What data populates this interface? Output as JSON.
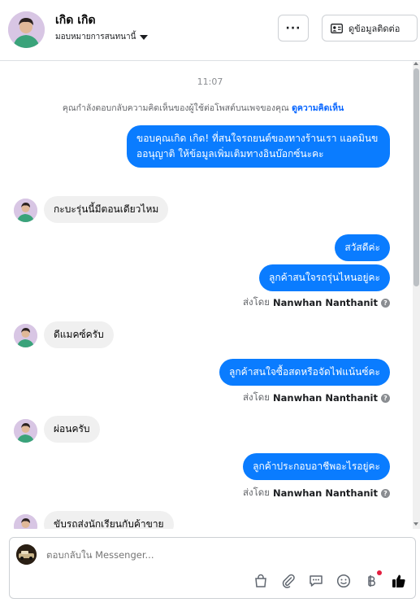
{
  "header": {
    "name": "เกิด เกิด",
    "assign_label": "มอบหมายการสนทนานี้",
    "more_label": "···",
    "contact_label": "ดูข้อมูลติดต่อ"
  },
  "thread": {
    "time": "11:07",
    "note_text": "คุณกำลังตอบกลับความคิดเห็นของผู้ใช้ต่อโพสต์บนเพจของคุณ ",
    "note_link": "ดูความคิดเห็น",
    "messages": [
      {
        "dir": "out",
        "text": "ขอบคุณเกิด เกิด! ที่สนใจรถยนต์ของทางร้านเรา แอดมินขออนุญาติ ให้ข้อมูลเพิ่มเติมทางอินบ๊อกซ์นะคะ"
      },
      {
        "dir": "in",
        "text": "กะบะรุ่นนี้มีตอนเดียวไหม"
      },
      {
        "dir": "out",
        "text": "สวัสดีค่ะ"
      },
      {
        "dir": "out",
        "text": "ลูกค้าสนใจรถรุ่นไหนอยู่คะ"
      },
      {
        "dir": "in",
        "text": "ดีแมคซ์ครับ"
      },
      {
        "dir": "out",
        "text": "ลูกค้าสนใจซื้อสดหรือจัดไฟแน้นซ์คะ"
      },
      {
        "dir": "in",
        "text": "ผ่อนครับ"
      },
      {
        "dir": "out",
        "text": "ลูกค้าประกอบอาชีพอะไรอยู่คะ"
      },
      {
        "dir": "in",
        "text": "ขับรถส่งนักเรียนกับค้าขาย"
      }
    ],
    "sent_by_prefix": "ส่งโดย",
    "sent_by_name": "Nanwhan Nanthanit",
    "help_glyph": "?"
  },
  "composer": {
    "placeholder": "ตอบกลับใน Messenger...",
    "tools": [
      "bag-icon",
      "attach-icon",
      "comment-icon",
      "emoji-icon",
      "baht-icon",
      "like-icon"
    ]
  },
  "colors": {
    "outgoing_bubble": "#0a7cff",
    "incoming_bubble": "#f0f0f0",
    "link": "#0866ff",
    "notification_dot": "#e41e3f"
  }
}
